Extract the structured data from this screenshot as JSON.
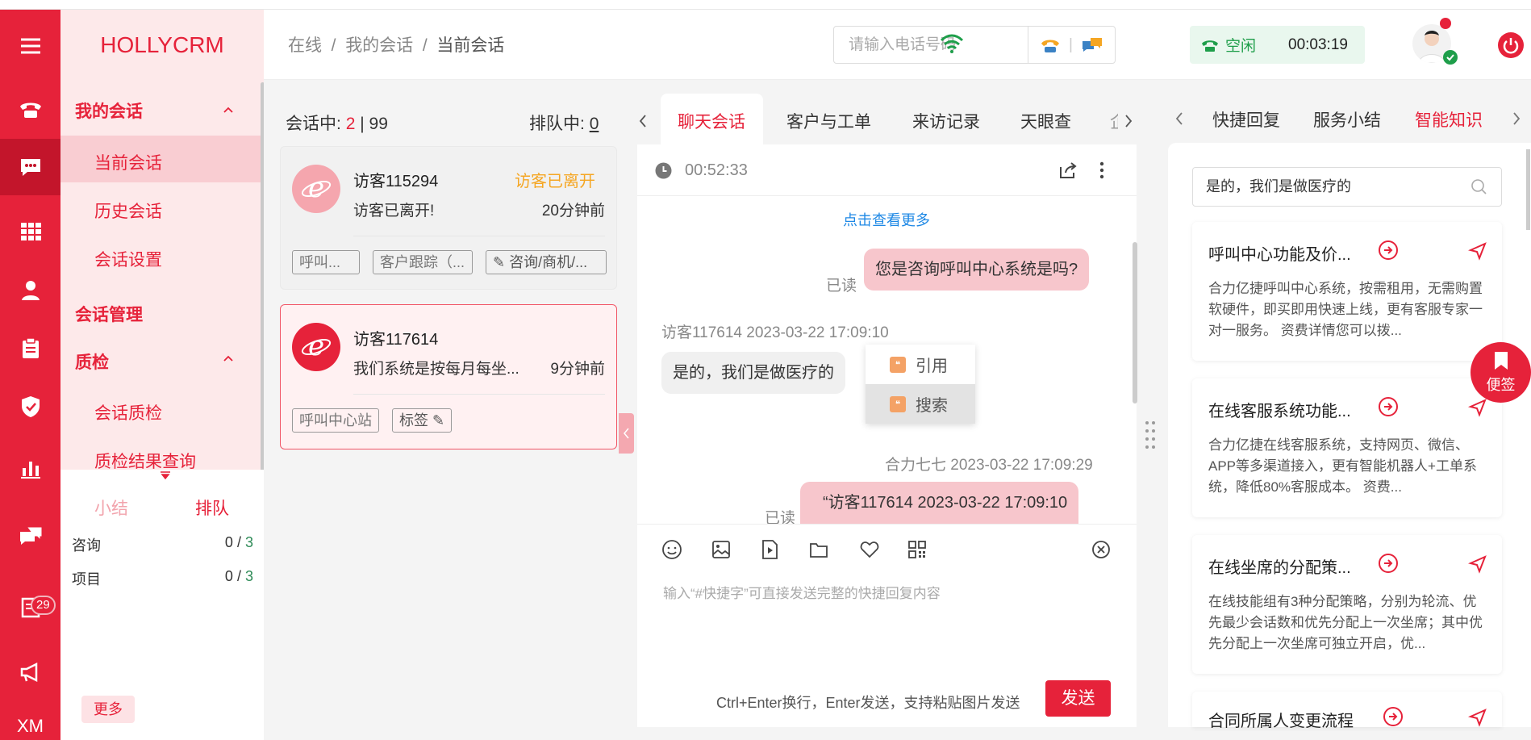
{
  "app": {
    "logo": "HOLLYCRM"
  },
  "rail": {
    "badge_count": "29",
    "bottom_label": "XM",
    "icons": [
      "menu-icon",
      "phone-icon",
      "chat-icon",
      "grid-icon",
      "user-icon",
      "clipboard-icon",
      "shield-icon",
      "bar-chart-icon",
      "message-icon",
      "book-icon",
      "megaphone-icon"
    ]
  },
  "nav": {
    "group_sessions": "我的会话",
    "current": "当前会话",
    "history": "历史会话",
    "settings": "会话设置",
    "management": "会话管理",
    "quality": "质检",
    "quality_session": "会话质检",
    "quality_result": "质检结果查询",
    "summary_tabs": [
      "小结",
      "排队"
    ],
    "rows": [
      {
        "label": "咨询",
        "done": "0",
        "sep": "/",
        "total": "3"
      },
      {
        "label": "项目",
        "done": "0",
        "sep": "/",
        "total": "3"
      }
    ],
    "more": "更多"
  },
  "header": {
    "breadcrumb": [
      "在线",
      "/",
      "我的会话",
      "/",
      "当前会话"
    ],
    "phone_placeholder": "请输入电话号码",
    "status_label": "空闲",
    "timer": "00:03:19"
  },
  "sessions": {
    "active_label": "会话中:",
    "active_count": "2",
    "divider": "|",
    "active_total": "99",
    "queue_label": "排队中:",
    "queue_count": "0",
    "cards": [
      {
        "name": "访客115294",
        "status": "访客已离开",
        "message": "访客已离开!",
        "time": "20分钟前",
        "tags": [
          "呼叫...",
          "客户跟踪（...",
          "咨询/商机/..."
        ]
      },
      {
        "name": "访客117614",
        "status": "",
        "message": "我们系统是按每月每坐...",
        "time": "9分钟前",
        "tags": [
          "呼叫中心站",
          "标签"
        ]
      }
    ]
  },
  "tabs": [
    "聊天会话",
    "客户与工单",
    "来访记录",
    "天眼查",
    "企"
  ],
  "chat": {
    "duration": "00:52:33",
    "load_more": "点击查看更多",
    "msg1": {
      "text": "您是咨询呼叫中心系统是吗?",
      "read": "已读"
    },
    "visitor_meta": "访客117614 2023-03-22 17:09:10",
    "msg2": {
      "text": "是的，我们是做医疗的"
    },
    "context_menu": [
      "引用",
      "搜索"
    ],
    "agent_meta": "合力七七 2023-03-22 17:09:29",
    "msg3": {
      "text": "“访客117614 2023-03-22 17:09:10",
      "read": "已读"
    },
    "input_placeholder": "输入“#快捷字”可直接发送完整的快捷回复内容",
    "hint": "Ctrl+Enter换行，Enter发送，支持粘贴图片发送",
    "send": "发送"
  },
  "right": {
    "tabs": [
      "快捷回复",
      "服务小结",
      "智能知识"
    ],
    "search_value": "是的，我们是做医疗的",
    "cards": [
      {
        "title": "呼叫中心功能及价...",
        "body": "合力亿捷呼叫中心系统，按需租用，无需购置软硬件，即买即用快速上线，更有客服专家一对一服务。 资费详情您可以拨..."
      },
      {
        "title": "在线客服系统功能...",
        "body": "合力亿捷在线客服系统，支持网页、微信、APP等多渠道接入，更有智能机器人+工单系统，降低80%客服成本。 资费..."
      },
      {
        "title": "在线坐席的分配策...",
        "body": "在线技能组有3种分配策略，分别为轮流、优先最少会话数和优先分配上一次坐席；其中优先分配上一次坐席可独立开启，优..."
      },
      {
        "title": "合同所属人变更流程",
        "body": ""
      }
    ],
    "note": "便签"
  },
  "colors": {
    "brand": "#e6223a",
    "idle": "#1e9e4a",
    "away": "#f5a623"
  }
}
